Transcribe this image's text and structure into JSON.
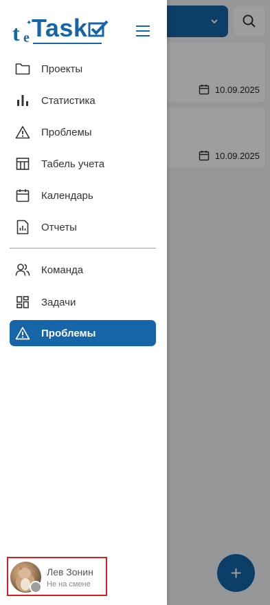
{
  "background": {
    "cards": [
      {
        "date": "10.09.2025"
      },
      {
        "date": "10.09.2025"
      }
    ],
    "fab_label": "+"
  },
  "drawer": {
    "logo": {
      "t": "t",
      "e": "e",
      "task": "Task"
    },
    "nav_top": [
      {
        "label": "Проекты",
        "icon": "folder-icon"
      },
      {
        "label": "Статистика",
        "icon": "bar-chart-icon"
      },
      {
        "label": "Проблемы",
        "icon": "warning-icon"
      },
      {
        "label": "Табель учета",
        "icon": "table-icon"
      },
      {
        "label": "Календарь",
        "icon": "calendar-icon"
      },
      {
        "label": "Отчеты",
        "icon": "report-icon"
      }
    ],
    "nav_bottom": [
      {
        "label": "Команда",
        "icon": "team-icon"
      },
      {
        "label": "Задачи",
        "icon": "dashboard-icon"
      },
      {
        "label": "Проблемы",
        "icon": "warning-icon",
        "active": true
      }
    ],
    "user": {
      "name": "Лев Зонин",
      "status": "Не на смене"
    }
  },
  "colors": {
    "accent": "#1565a8",
    "highlight_border": "#e0191f",
    "status_offline": "#9e9e9e"
  }
}
